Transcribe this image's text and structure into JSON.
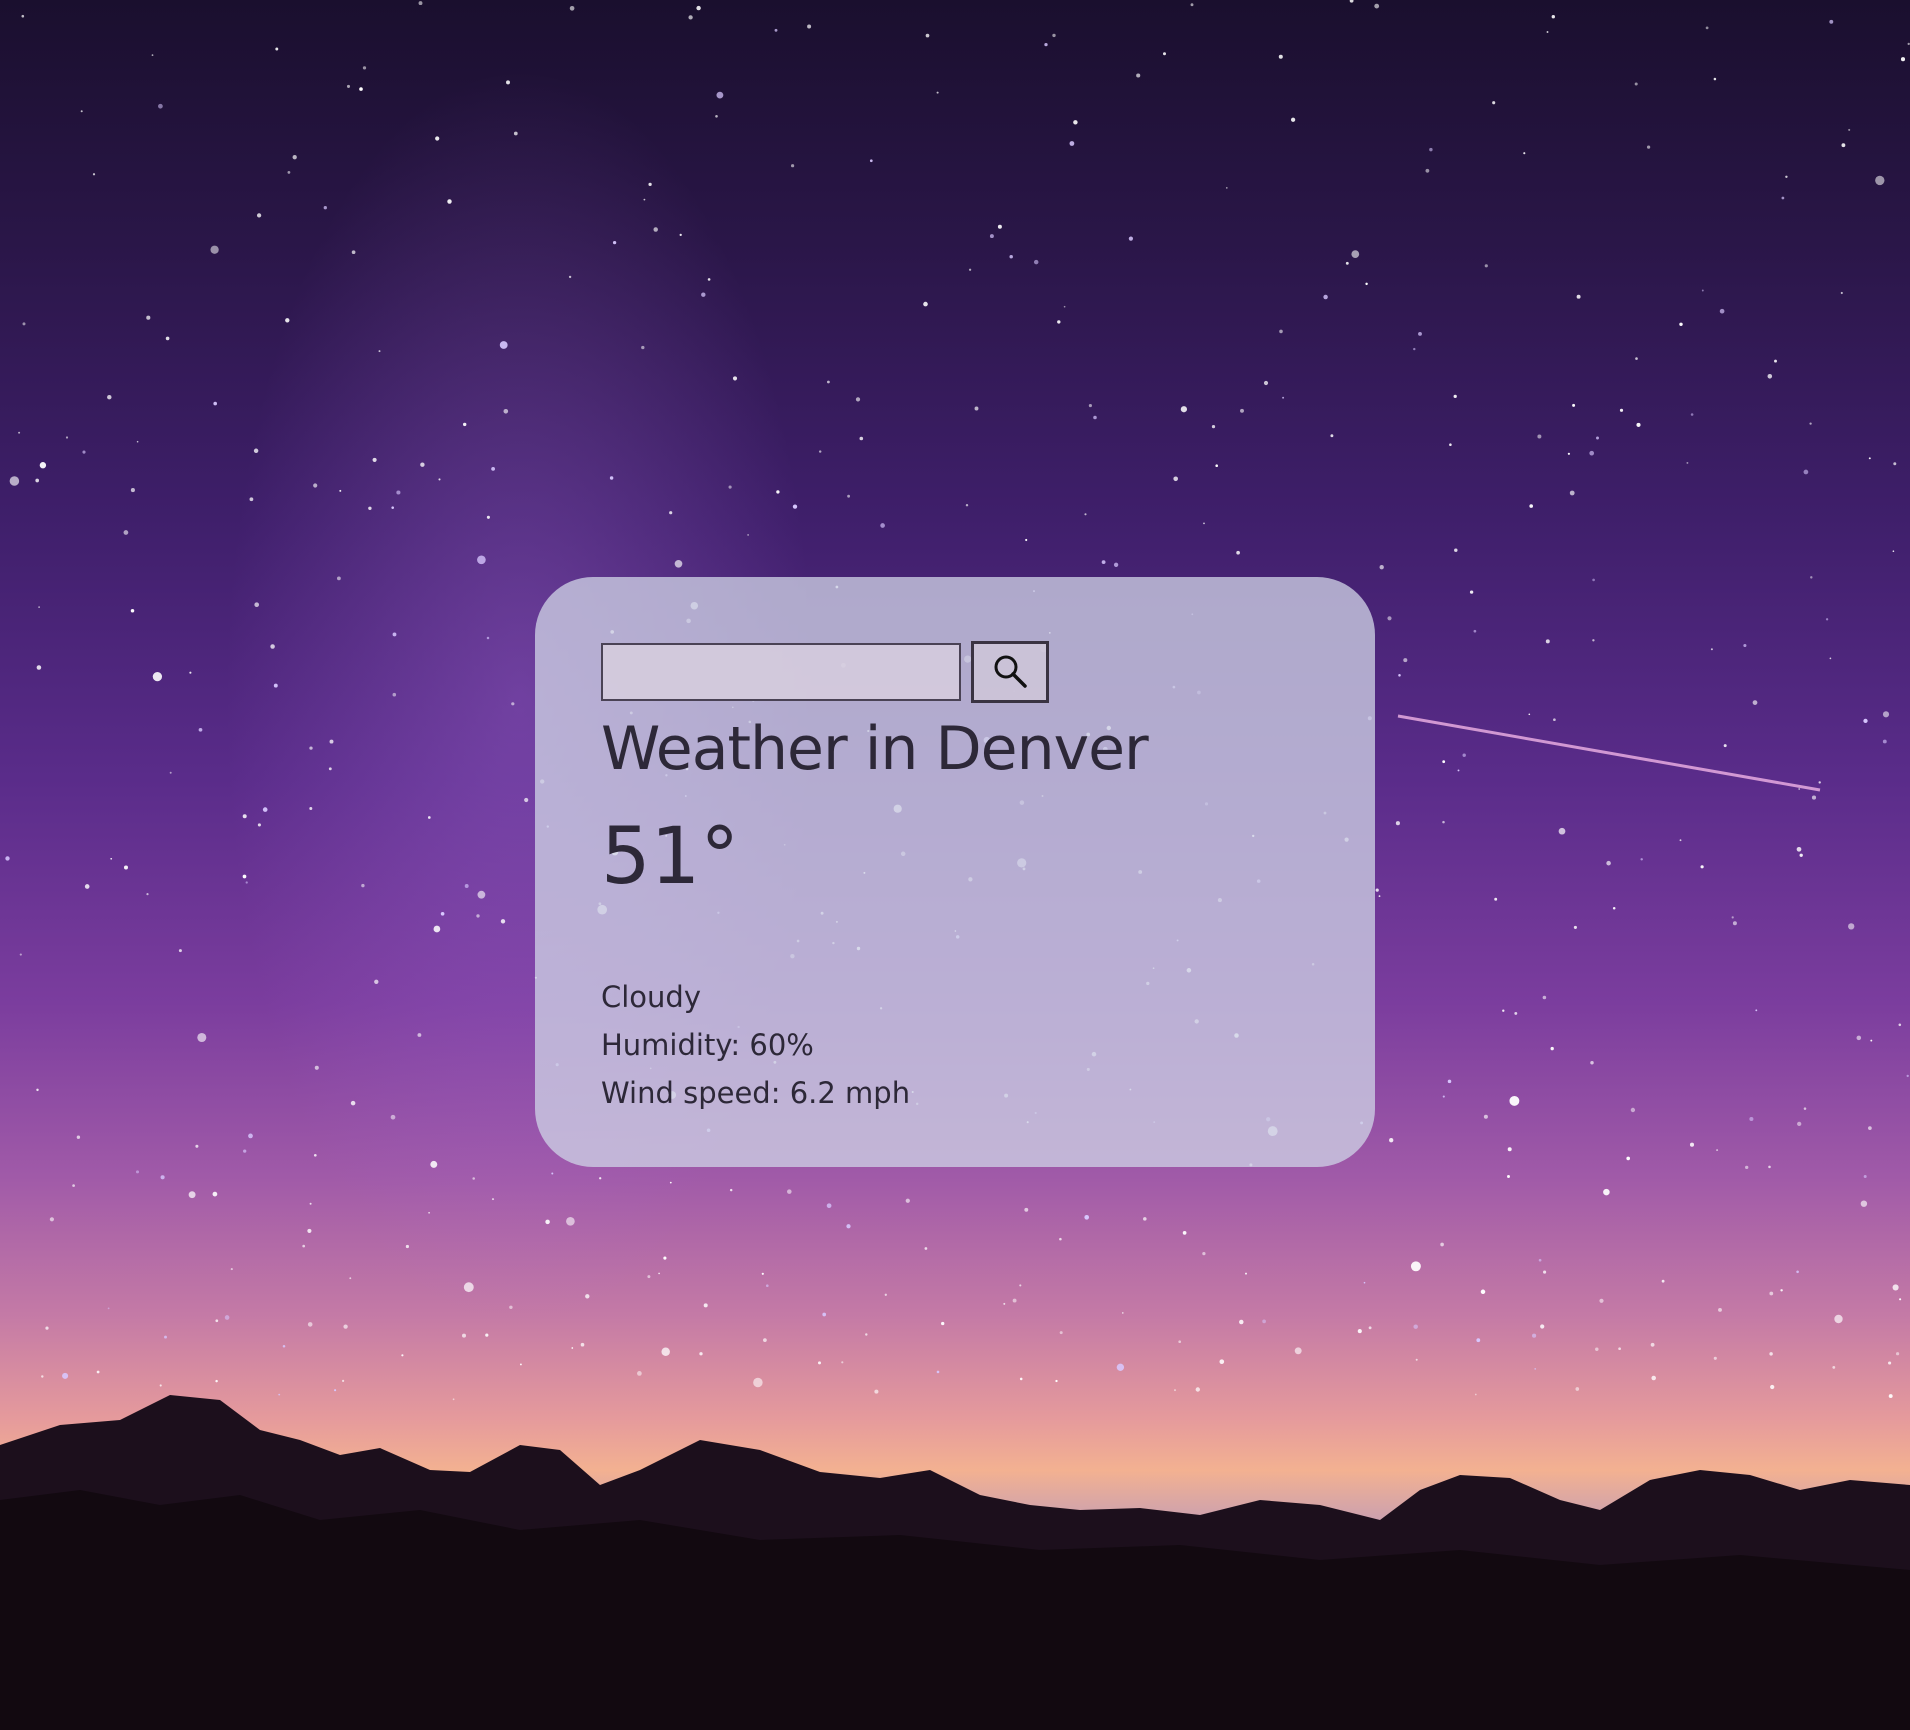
{
  "search": {
    "value": "",
    "placeholder": "",
    "button_icon": "search-icon"
  },
  "weather": {
    "title": "Weather in Denver",
    "temperature": "51°",
    "condition": "Cloudy",
    "humidity": "Humidity: 60%",
    "wind": "Wind speed: 6.2 mph"
  },
  "background": {
    "description_icon": "night-sky-mountains",
    "colors": {
      "sky_top": "#1a0f2e",
      "sky_mid": "#5a2c8a",
      "horizon": "#f3b191",
      "mountains": "#120a12"
    }
  },
  "card": {
    "color": "#cdd0e4",
    "text_color": "#2d2838"
  }
}
